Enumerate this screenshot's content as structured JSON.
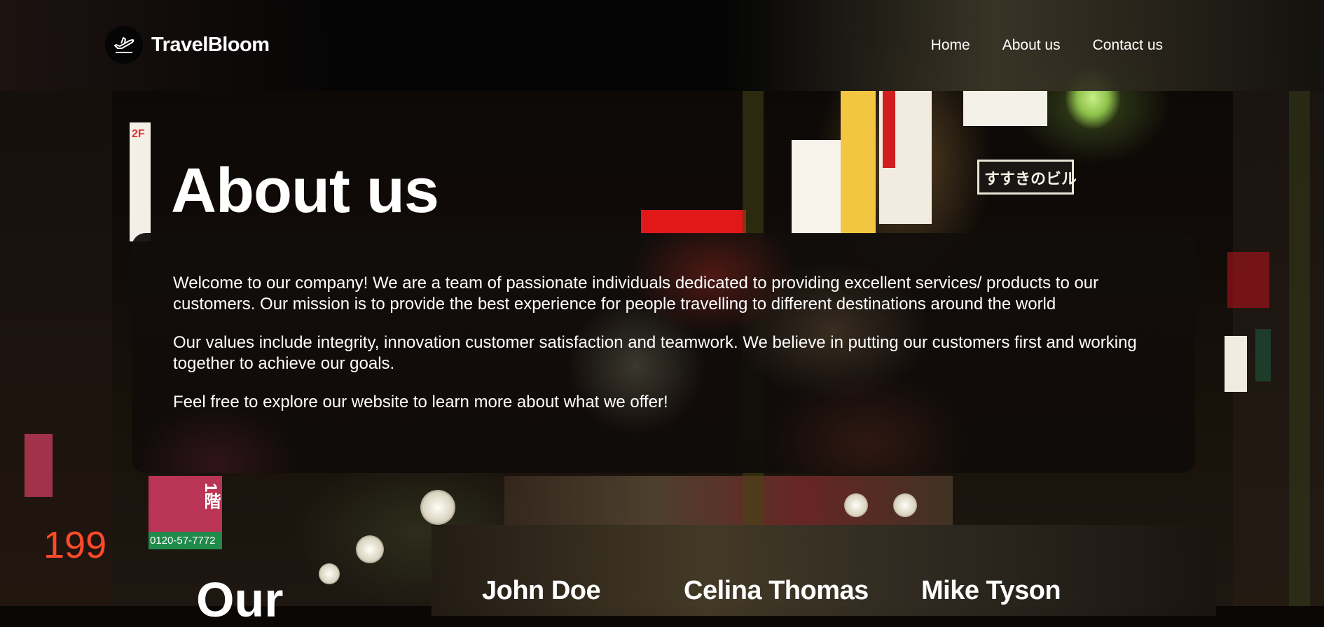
{
  "header": {
    "brand": "TravelBloom",
    "nav": [
      {
        "label": "Home"
      },
      {
        "label": "About us"
      },
      {
        "label": "Contact us"
      }
    ]
  },
  "main": {
    "title": "About us",
    "paragraphs": [
      "Welcome to our company! We are a team of passionate individuals dedicated to providing excellent services/ products to our customers. Our mission is to provide the best experience for people travelling to different destinations around the world",
      "Our values include integrity, innovation customer satisfaction and teamwork. We believe in putting our customers first and working together to achieve our goals.",
      "Feel free to explore our website to learn more about what we offer!"
    ]
  },
  "team": {
    "title": "Our",
    "members": [
      {
        "name": "John Doe"
      },
      {
        "name": "Celina Thomas"
      },
      {
        "name": "Mike Tyson"
      }
    ]
  },
  "background": {
    "signs": [
      "すすきのビル",
      "2F",
      "1階",
      "0120-57-7772",
      "199"
    ]
  },
  "colors": {
    "text": "#ffffff",
    "header_bg": "#050505"
  }
}
